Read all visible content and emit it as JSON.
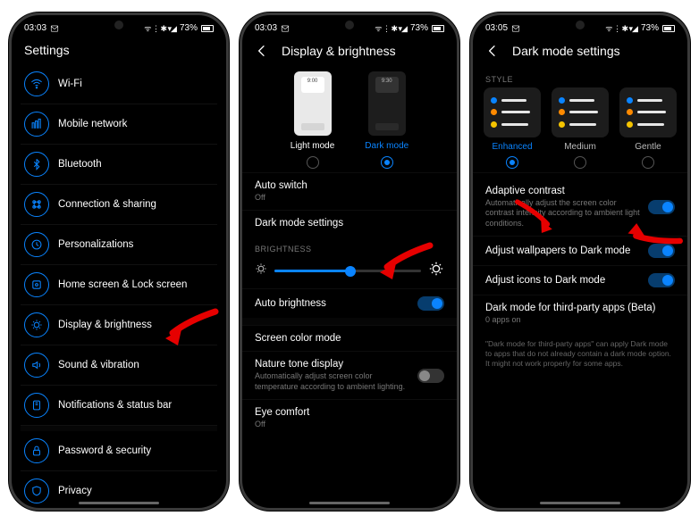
{
  "status": {
    "time1": "03:03",
    "time2": "03:03",
    "time3": "03:05",
    "battery": "73%"
  },
  "phone1": {
    "title": "Settings",
    "items": [
      {
        "label": "Wi-Fi"
      },
      {
        "label": "Mobile network"
      },
      {
        "label": "Bluetooth"
      },
      {
        "label": "Connection & sharing"
      },
      {
        "label": "Personalizations"
      },
      {
        "label": "Home screen & Lock screen"
      },
      {
        "label": "Display & brightness"
      },
      {
        "label": "Sound & vibration"
      },
      {
        "label": "Notifications & status bar"
      },
      {
        "label": "Password & security"
      },
      {
        "label": "Privacy"
      }
    ]
  },
  "phone2": {
    "title": "Display & brightness",
    "light_mode": "Light mode",
    "dark_mode": "Dark mode",
    "light_time": "9:00",
    "dark_time": "9:30",
    "auto_switch": "Auto switch",
    "auto_switch_val": "Off",
    "dark_mode_settings": "Dark mode settings",
    "brightness_label": "BRIGHTNESS",
    "auto_brightness": "Auto brightness",
    "screen_color_mode": "Screen color mode",
    "nature_tone": "Nature tone display",
    "nature_tone_desc": "Automatically adjust screen color temperature according to ambient lighting.",
    "eye_comfort": "Eye comfort",
    "eye_comfort_val": "Off"
  },
  "phone3": {
    "title": "Dark mode settings",
    "style_label": "STYLE",
    "enhanced": "Enhanced",
    "medium": "Medium",
    "gentle": "Gentle",
    "adaptive": "Adaptive contrast",
    "adaptive_desc": "Automatically adjust the screen color contrast intensity according to ambient light conditions.",
    "adjust_wallpapers": "Adjust wallpapers to Dark mode",
    "adjust_icons": "Adjust icons to Dark mode",
    "third_party": "Dark mode for third-party apps (Beta)",
    "third_party_val": "0 apps on",
    "note": "\"Dark mode for third-party apps\" can apply Dark mode to apps that do not already contain a dark mode option. It might not work properly for some apps."
  }
}
